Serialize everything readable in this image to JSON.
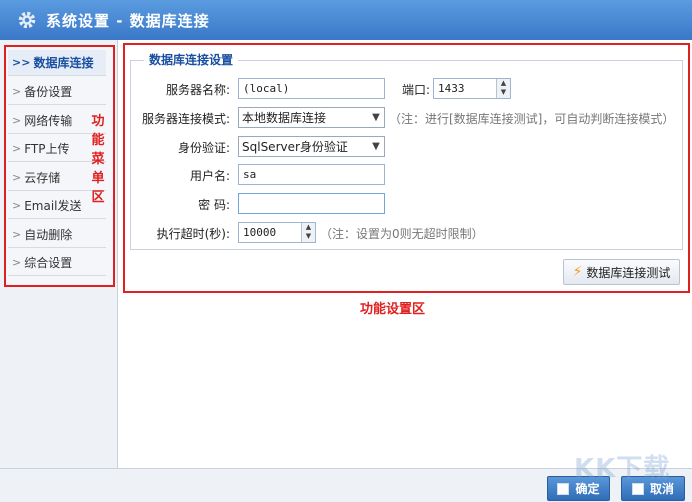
{
  "window": {
    "title": "系统设置 - 数据库连接"
  },
  "sidebar": {
    "items": [
      {
        "label": "数据库连接",
        "active": true
      },
      {
        "label": "备份设置"
      },
      {
        "label": "网络传输"
      },
      {
        "label": "FTP上传"
      },
      {
        "label": "云存储"
      },
      {
        "label": "Email发送"
      },
      {
        "label": "自动删除"
      },
      {
        "label": "综合设置"
      }
    ],
    "annotation": "功能菜单区"
  },
  "settings": {
    "legend": "数据库连接设置",
    "server_name_label": "服务器名称:",
    "server_name_value": "(local)",
    "port_label": "端口:",
    "port_value": "1433",
    "mode_label": "服务器连接模式:",
    "mode_value": "本地数据库连接",
    "mode_hint": "（注：进行[数据库连接测试]，可自动判断连接模式）",
    "auth_label": "身份验证:",
    "auth_value": "SqlServer身份验证",
    "user_label": "用户名:",
    "user_value": "sa",
    "password_label": "密 码:",
    "password_value": "",
    "timeout_label": "执行超时(秒):",
    "timeout_value": "10000",
    "timeout_hint": "（注：设置为0则无超时限制）",
    "test_button": "数据库连接测试",
    "annotation": "功能设置区"
  },
  "footer": {
    "ok_label": "确定",
    "cancel_label": "取消"
  },
  "watermark": "KK下载",
  "colors": {
    "title_bar": "#3a78c8",
    "annotation": "#e02020",
    "legend": "#1a4fa0"
  }
}
